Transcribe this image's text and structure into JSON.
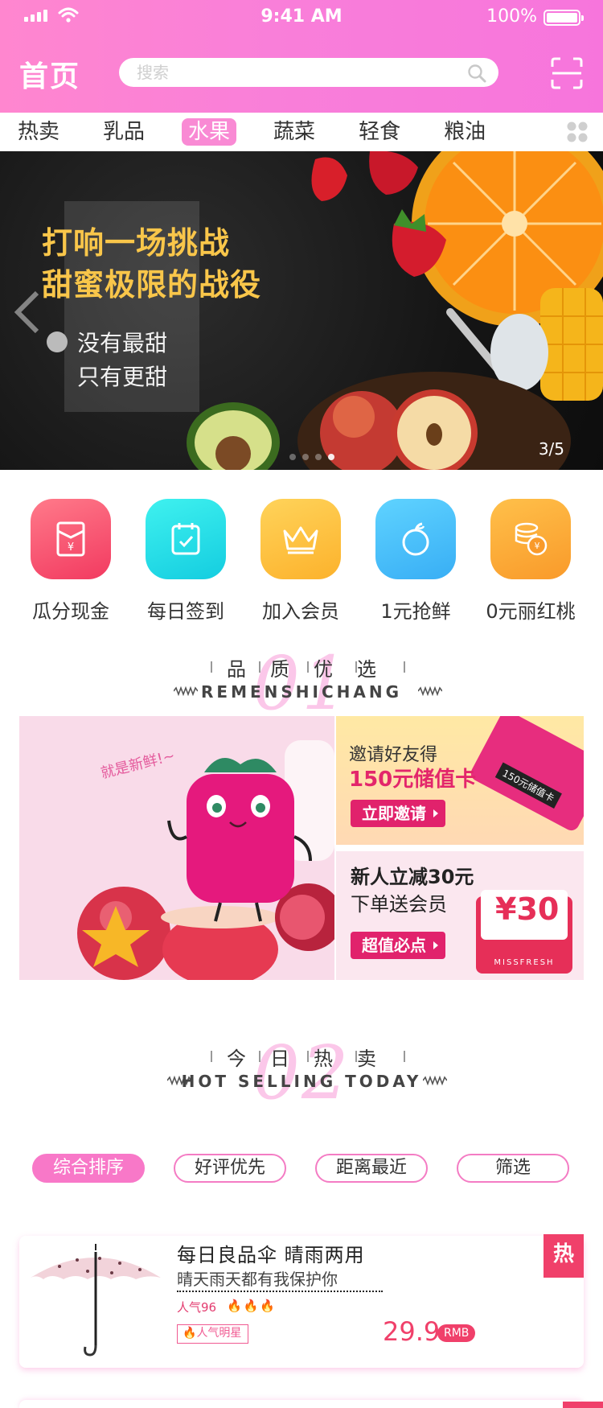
{
  "status_bar": {
    "time": "9:41 AM",
    "battery": "100%",
    "battery_level": 1.0
  },
  "header": {
    "title": "首页",
    "search_placeholder": "搜索"
  },
  "tabs": [
    {
      "label": "热卖",
      "active": false
    },
    {
      "label": "乳品",
      "active": false
    },
    {
      "label": "水果",
      "active": true
    },
    {
      "label": "蔬菜",
      "active": false
    },
    {
      "label": "轻食",
      "active": false
    },
    {
      "label": "粮油",
      "active": false
    }
  ],
  "banner": {
    "headline_1": "打响一场挑战",
    "headline_2": "甜蜜极限的战役",
    "sub_1": "没有最甜",
    "sub_2": "只有更甜",
    "page": "3/5"
  },
  "shortcuts": [
    {
      "label": "瓜分现金",
      "icon": "red-envelope-icon",
      "color": "#f5506e"
    },
    {
      "label": "每日签到",
      "icon": "calendar-check-icon",
      "color": "#1fd9e2"
    },
    {
      "label": "加入会员",
      "icon": "crown-icon",
      "color": "#fdbf3a"
    },
    {
      "label": "1元抢鲜",
      "icon": "apple-icon",
      "color": "#48c4f5"
    },
    {
      "label": "0元丽红桃",
      "icon": "coins-icon",
      "color": "#fbaa35"
    }
  ],
  "section1": {
    "number": "01",
    "title_chars": [
      "品",
      "质",
      "优",
      "选"
    ],
    "subtitle": "REMENSHICHANG"
  },
  "promo": {
    "tagline": "就是新鲜!~",
    "invite_text": "邀请好友得",
    "invite_value": "150元储值卡",
    "invite_button": "立即邀请",
    "card_label": "150元储值卡",
    "new_user_text": "新人立减30元",
    "new_user_gift": "下单送会员",
    "new_user_button": "超值必点",
    "envelope_amount": "¥30",
    "envelope_brand": "MISSFRESH"
  },
  "section2": {
    "number": "02",
    "title_chars": [
      "今",
      "日",
      "热",
      "卖"
    ],
    "subtitle": "HOT SELLING TODAY"
  },
  "filters": [
    {
      "label": "综合排序",
      "active": true
    },
    {
      "label": "好评优先",
      "active": false
    },
    {
      "label": "距离最近",
      "active": false
    },
    {
      "label": "筛选",
      "active": false
    }
  ],
  "product": {
    "title": "每日良品伞  晴雨两用",
    "description": "晴天雨天都有我保护你",
    "popularity": "人气96",
    "flames": "🔥🔥🔥",
    "tag": "人气明星",
    "price": "29.9",
    "unit": "RMB",
    "badge": "热"
  },
  "colors": {
    "brand_pink": "#f97fd9",
    "accent_red": "#f0406a",
    "section_number": "#fbc7e9"
  }
}
